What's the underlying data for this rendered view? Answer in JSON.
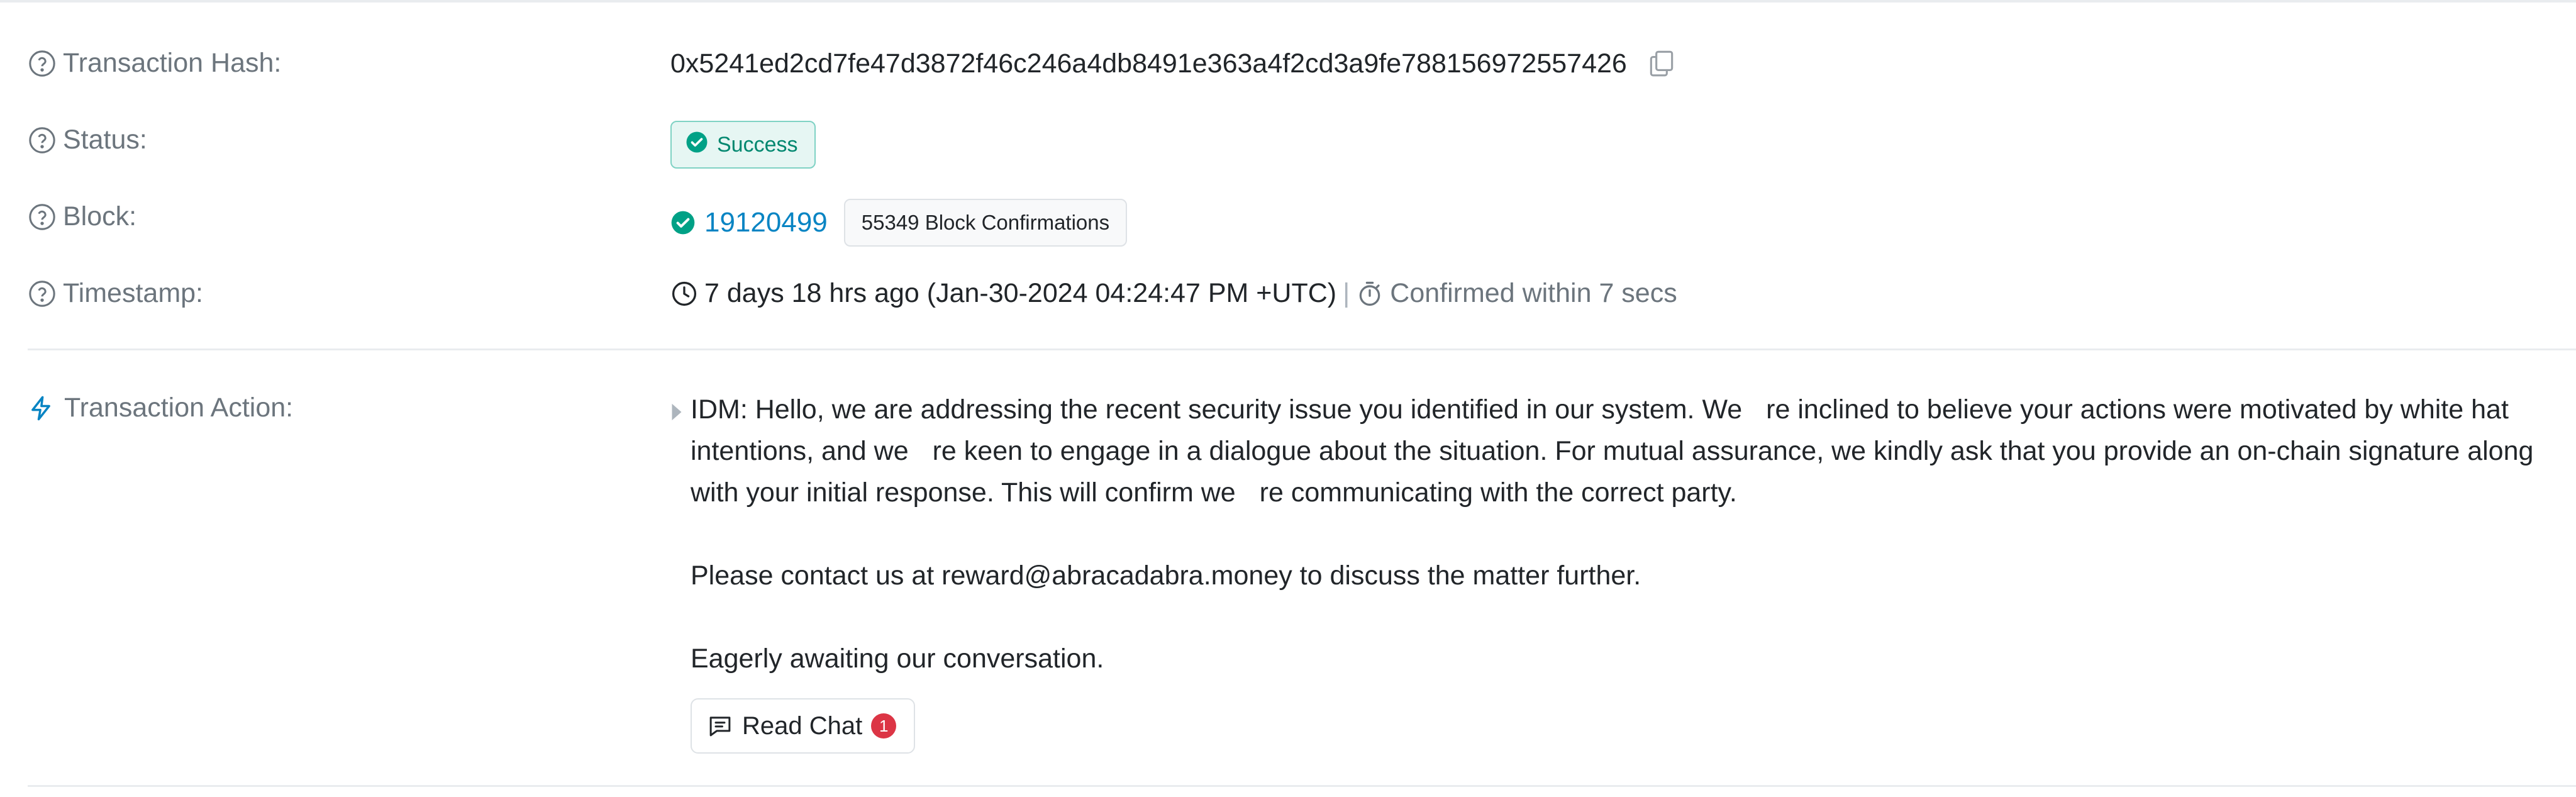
{
  "tx_hash": {
    "label": "Transaction Hash:",
    "value": "0x5241ed2cd7fe47d3872f46c246a4db8491e363a4f2cd3a9fe788156972557426",
    "copy_icon": "copy-icon"
  },
  "status": {
    "label": "Status:",
    "value": "Success",
    "color": "#00876f"
  },
  "block": {
    "label": "Block:",
    "number": "19120499",
    "confirmations": "55349 Block Confirmations",
    "link_color": "#0784c3"
  },
  "timestamp": {
    "label": "Timestamp:",
    "value": "7 days 18 hrs ago (Jan-30-2024 04:24:47 PM +UTC)",
    "separator": "|",
    "confirmed": "Confirmed within 7 secs"
  },
  "action": {
    "label": "Transaction Action:",
    "paragraphs": [
      "IDM: Hello, we are addressing the recent security issue you identified in our system. We re inclined to believe your actions were motivated by white hat intentions, and we re keen to engage in a dialogue about the situation. For mutual assurance, we kindly ask that you provide an on-chain signature along with your initial response. This will confirm we re communicating with the correct party.",
      "Please contact us at reward@abracadabra.money to discuss the matter further.",
      "Eagerly awaiting our conversation."
    ],
    "read_chat_label": "Read Chat",
    "unread_count": "1"
  }
}
